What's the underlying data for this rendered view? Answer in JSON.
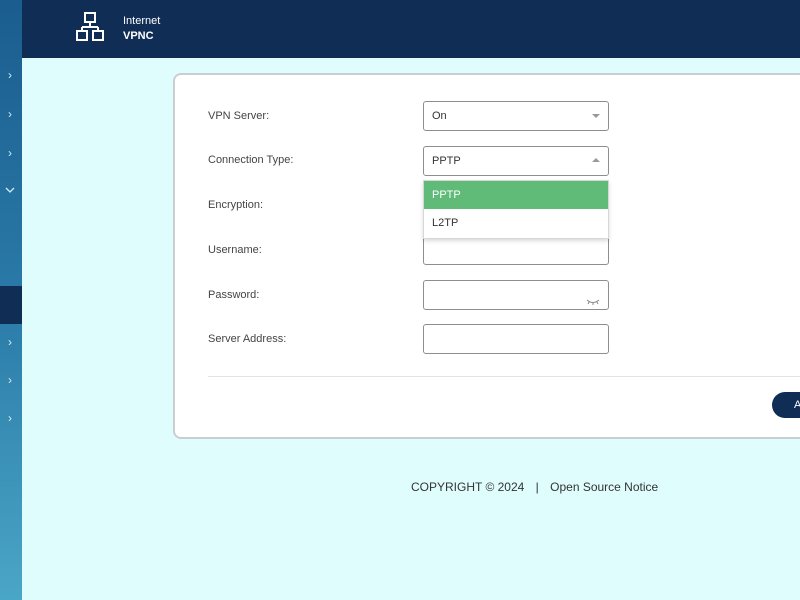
{
  "header": {
    "section": "Internet",
    "page": "VPNC"
  },
  "sidebar": {
    "chevrons": [
      "chevron-right",
      "chevron-right",
      "chevron-right",
      "chevron-down",
      "chevron-right",
      "chevron-right",
      "chevron-right"
    ]
  },
  "form": {
    "vpn_server": {
      "label": "VPN Server:",
      "value": "On"
    },
    "connection_type": {
      "label": "Connection Type:",
      "value": "PPTP"
    },
    "encryption": {
      "label": "Encryption:",
      "value": ""
    },
    "username": {
      "label": "Username:",
      "value": ""
    },
    "password": {
      "label": "Password:",
      "value": ""
    },
    "server_address": {
      "label": "Server Address:",
      "value": ""
    }
  },
  "dropdown": {
    "options": [
      "PPTP",
      "L2TP"
    ],
    "selected": "PPTP"
  },
  "actions": {
    "apply_label": "A"
  },
  "footer": {
    "copyright": "COPYRIGHT © 2024",
    "separator": "|",
    "notice_link": "Open Source Notice"
  },
  "colors": {
    "header_bg": "#0f2d55",
    "page_bg": "#e0fdfe",
    "selected_option": "#5fbb77"
  }
}
